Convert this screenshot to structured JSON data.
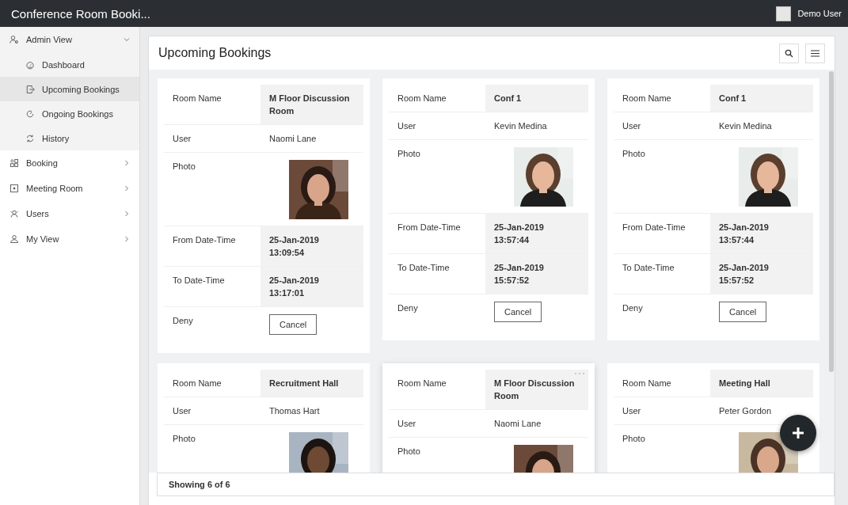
{
  "header": {
    "app_title": "Conference Room Booki...",
    "user_name": "Demo User"
  },
  "sidebar": {
    "items": [
      {
        "label": "Admin View",
        "expanded": true,
        "children": [
          {
            "label": "Dashboard",
            "selected": false
          },
          {
            "label": "Upcoming Bookings",
            "selected": true
          },
          {
            "label": "Ongoing Bookings",
            "selected": false
          },
          {
            "label": "History",
            "selected": false
          }
        ]
      },
      {
        "label": "Booking",
        "expanded": false
      },
      {
        "label": "Meeting Room",
        "expanded": false
      },
      {
        "label": "Users",
        "expanded": false
      },
      {
        "label": "My View",
        "expanded": false
      }
    ]
  },
  "panel": {
    "title": "Upcoming Bookings",
    "footer": "Showing 6 of 6"
  },
  "cards": [
    {
      "hovered": false,
      "rows": [
        {
          "kind": "shaded",
          "label": "Room Name",
          "value": "M Floor Discussion Room"
        },
        {
          "kind": "text",
          "label": "User",
          "value": "Naomi Lane"
        },
        {
          "label": "Photo"
        },
        {
          "kind": "shaded",
          "label": "From Date-Time",
          "value": "25-Jan-2019 13:09:54"
        },
        {
          "kind": "shaded",
          "label": "To Date-Time",
          "value": "25-Jan-2019 13:17:01"
        },
        {
          "kind": "button",
          "label": "Deny",
          "value": "Cancel"
        }
      ]
    },
    {
      "hovered": false,
      "rows": [
        {
          "kind": "shaded",
          "label": "Room Name",
          "value": "Conf 1"
        },
        {
          "kind": "text",
          "label": "User",
          "value": "Kevin Medina"
        },
        {
          "label": "Photo"
        },
        {
          "kind": "shaded",
          "label": "From Date-Time",
          "value": "25-Jan-2019 13:57:44"
        },
        {
          "kind": "shaded",
          "label": "To Date-Time",
          "value": "25-Jan-2019 15:57:52"
        },
        {
          "kind": "button",
          "label": "Deny",
          "value": "Cancel"
        }
      ]
    },
    {
      "hovered": false,
      "rows": [
        {
          "kind": "shaded",
          "label": "Room Name",
          "value": "Conf 1"
        },
        {
          "kind": "text",
          "label": "User",
          "value": "Kevin Medina"
        },
        {
          "label": "Photo"
        },
        {
          "kind": "shaded",
          "label": "From Date-Time",
          "value": "25-Jan-2019 13:57:44"
        },
        {
          "kind": "shaded",
          "label": "To Date-Time",
          "value": "25-Jan-2019 15:57:52"
        },
        {
          "kind": "button",
          "label": "Deny",
          "value": "Cancel"
        }
      ]
    },
    {
      "hovered": false,
      "rows": [
        {
          "kind": "shaded",
          "label": "Room Name",
          "value": "Recruitment Hall"
        },
        {
          "kind": "text",
          "label": "User",
          "value": "Thomas Hart"
        },
        {
          "label": "Photo"
        }
      ]
    },
    {
      "hovered": true,
      "rows": [
        {
          "kind": "shaded",
          "label": "Room Name",
          "value": "M Floor Discussion Room"
        },
        {
          "kind": "text",
          "label": "User",
          "value": "Naomi Lane"
        },
        {
          "label": "Photo"
        }
      ]
    },
    {
      "hovered": false,
      "rows": [
        {
          "kind": "shaded",
          "label": "Room Name",
          "value": "Meeting Hall"
        },
        {
          "kind": "text",
          "label": "User",
          "value": "Peter Gordon"
        },
        {
          "label": "Photo"
        }
      ]
    }
  ]
}
